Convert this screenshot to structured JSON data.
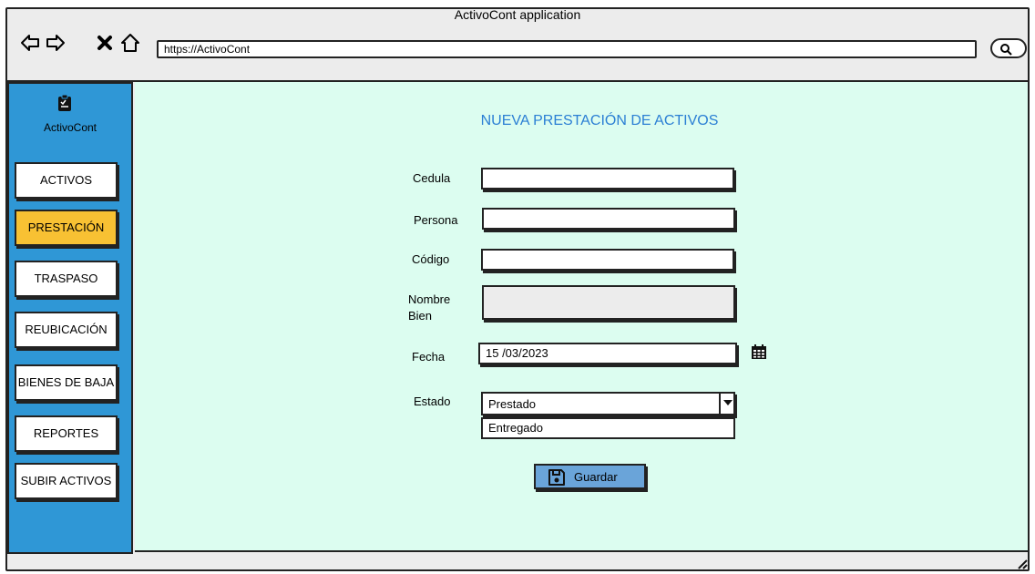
{
  "window": {
    "title": "ActivoCont application"
  },
  "browser": {
    "url": "https://ActivoCont",
    "icons": [
      "back-icon",
      "forward-icon",
      "close-icon",
      "home-icon",
      "search-icon"
    ]
  },
  "sidebar": {
    "logo_text": "ActivoCont",
    "items": [
      {
        "label": "ACTIVOS",
        "active": false
      },
      {
        "label": "PRESTACIÓN",
        "active": true
      },
      {
        "label": "TRASPASO",
        "active": false
      },
      {
        "label": "REUBICACIÓN",
        "active": false
      },
      {
        "label": "BIENES DE BAJA",
        "active": false
      },
      {
        "label": "REPORTES",
        "active": false
      },
      {
        "label": "SUBIR ACTIVOS",
        "active": false
      }
    ]
  },
  "form": {
    "title": "NUEVA PRESTACIÓN DE ACTIVOS",
    "cedula": {
      "label": "Cedula",
      "value": ""
    },
    "persona": {
      "label": "Persona",
      "value": ""
    },
    "codigo": {
      "label": "Código",
      "value": ""
    },
    "nombre_bien": {
      "label_line1": "Nombre",
      "label_line2": "Bien",
      "value": ""
    },
    "fecha": {
      "label": "Fecha",
      "value": "15 /03/2023"
    },
    "estado": {
      "label": "Estado",
      "selected": "Prestado",
      "options": [
        "Entregado"
      ]
    },
    "save_label": "Guardar"
  },
  "colors": {
    "sidebar_bg": "#2f97d6",
    "active_item": "#f8c133",
    "content_bg": "#dcfdf0",
    "title_color": "#2b7fd4",
    "save_button": "#6aa4d9"
  }
}
